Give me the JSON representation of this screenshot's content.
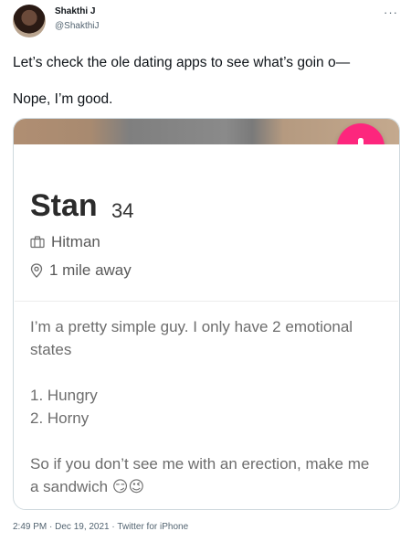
{
  "tweet": {
    "user_name": "Shakthi J",
    "user_handle": "@ShakthiJ",
    "line1": "Let’s check the ole dating apps to see what’s goin o—",
    "line2": "Nope, I’m good.",
    "footer": "2:49 PM · Dec 19, 2021 · Twitter for iPhone"
  },
  "profile": {
    "name": "Stan",
    "age": "34",
    "job": "Hitman",
    "distance": "1 mile away",
    "bio": {
      "p1": "I’m a pretty simple guy. I only have 2 emotional states",
      "item1": "1. Hungry",
      "item2": "2. Horny",
      "p3": "So if you don’t see me with an erection, make me a sandwich 😏😉"
    }
  },
  "colors": {
    "accent": "#fd267d",
    "secondary_text": "#536471"
  },
  "icons": [
    "more-icon",
    "arrow-down-icon",
    "briefcase-icon",
    "location-pin-icon"
  ]
}
